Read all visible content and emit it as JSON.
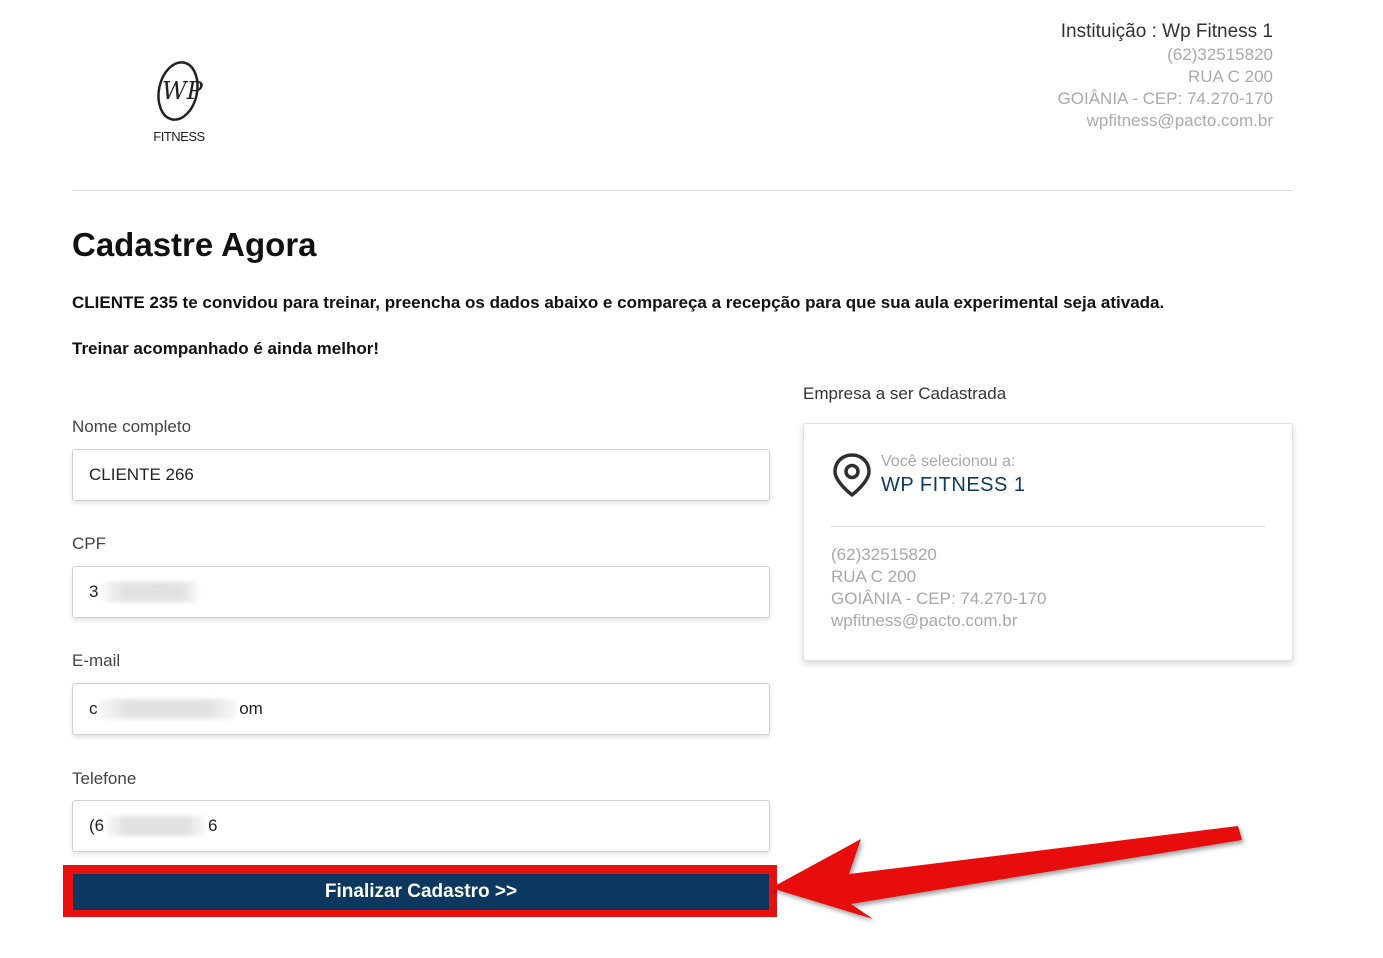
{
  "header": {
    "logo_text": "WP",
    "logo_subtext": "FITNESS",
    "institution": "Instituição : Wp Fitness 1",
    "phone": "(62)32515820",
    "address": "RUA C 200",
    "city": "GOIÂNIA - CEP: 74.270-170",
    "email": "wpfitness@pacto.com.br"
  },
  "main": {
    "title": "Cadastre Agora",
    "intro": "CLIENTE 235 te convidou para treinar, preencha os dados abaixo e compareça a recepção para que sua aula experimental seja ativada.",
    "intro2": "Treinar acompanhado é ainda melhor!"
  },
  "form": {
    "name_label": "Nome completo",
    "name_value": "CLIENTE 266",
    "cpf_label": "CPF",
    "cpf_value": "3            5",
    "email_label": "E-mail",
    "email_value": "c                              om",
    "phone_label": "Telefone",
    "phone_value": "(6                      6",
    "submit_label": "Finalizar Cadastro >>"
  },
  "company": {
    "label": "Empresa a ser Cadastrada",
    "selected_label": "Você selecionou a:",
    "name": "WP FITNESS 1",
    "phone": "(62)32515820",
    "address": "RUA C 200",
    "city": "GOIÂNIA - CEP: 74.270-170",
    "email": "wpfitness@pacto.com.br",
    "icon": "map-pin-icon"
  },
  "annotation": {
    "highlight_color": "#e80f0f",
    "button_color": "#0c3860"
  }
}
